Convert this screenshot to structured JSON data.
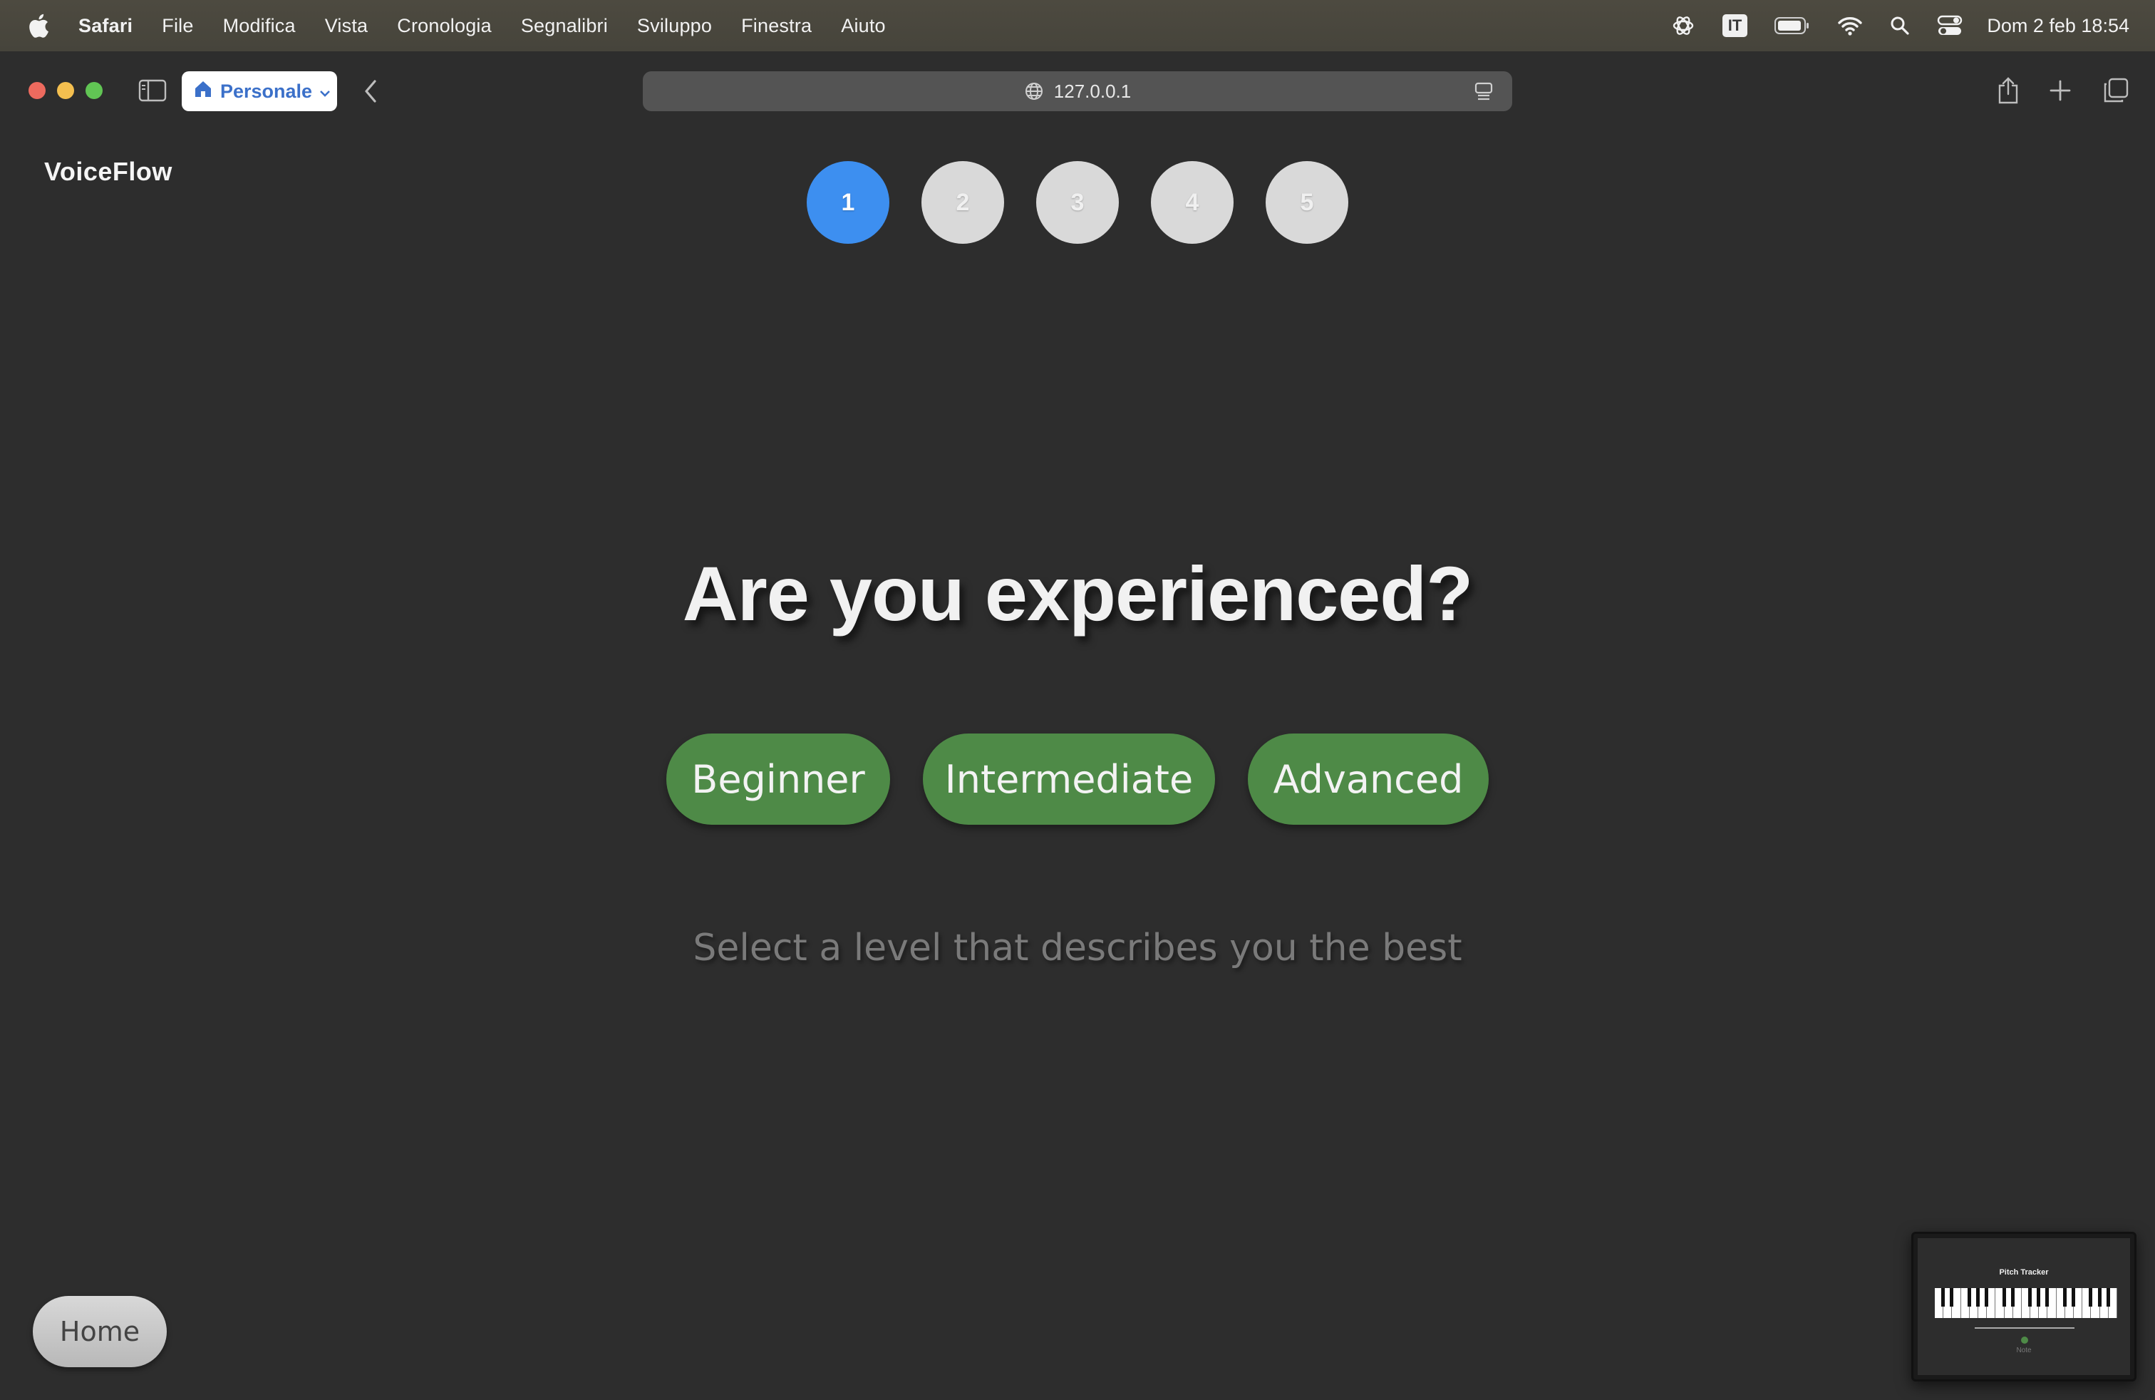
{
  "menubar": {
    "app_name": "Safari",
    "items": [
      "File",
      "Modifica",
      "Vista",
      "Cronologia",
      "Segnalibri",
      "Sviluppo",
      "Finestra",
      "Aiuto"
    ],
    "input_source": "IT",
    "clock": "Dom 2 feb  18:54"
  },
  "browser": {
    "profile_label": "Personale",
    "url": "127.0.0.1"
  },
  "page": {
    "brand": "VoiceFlow",
    "steps": [
      "1",
      "2",
      "3",
      "4",
      "5"
    ],
    "active_step": 1,
    "question": "Are you experienced?",
    "levels": [
      "Beginner",
      "Intermediate",
      "Advanced"
    ],
    "hint": "Select a level that describes you the best",
    "home_label": "Home"
  },
  "thumbnail": {
    "title": "Pitch Tracker",
    "note": "Note"
  },
  "colors": {
    "background": "#2d2d2d",
    "active_step": "#3d8ff0",
    "inactive_step": "#d9d9d9",
    "level_button": "#4e8a47",
    "hint_text": "#7a7a7a"
  }
}
